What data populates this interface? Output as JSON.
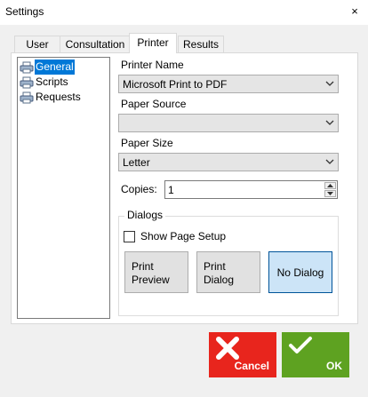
{
  "window": {
    "title": "Settings",
    "close_glyph": "×"
  },
  "tabs": [
    {
      "label": "User"
    },
    {
      "label": "Consultation"
    },
    {
      "label": "Printer",
      "active": true
    },
    {
      "label": "Results"
    }
  ],
  "tree": {
    "items": [
      {
        "label": "General",
        "icon": "printer-icon",
        "selected": true
      },
      {
        "label": "Scripts",
        "icon": "printer-icon"
      },
      {
        "label": "Requests",
        "icon": "printer-icon"
      }
    ]
  },
  "printer": {
    "printer_name_label": "Printer Name",
    "printer_name_value": "Microsoft Print to PDF",
    "paper_source_label": "Paper Source",
    "paper_source_value": "",
    "paper_size_label": "Paper Size",
    "paper_size_value": "Letter",
    "copies_label": "Copies:",
    "copies_value": "1"
  },
  "dialogs": {
    "group_label": "Dialogs",
    "show_page_setup_label": "Show Page Setup",
    "show_page_setup_checked": false,
    "buttons": [
      {
        "label": "Print\nPreview",
        "selected": false
      },
      {
        "label": "Print\nDialog",
        "selected": false
      },
      {
        "label": "No Dialog",
        "selected": true
      }
    ]
  },
  "footer": {
    "cancel_label": "Cancel",
    "ok_label": "OK",
    "cancel_color": "#e8251d",
    "ok_color": "#5ea221"
  }
}
